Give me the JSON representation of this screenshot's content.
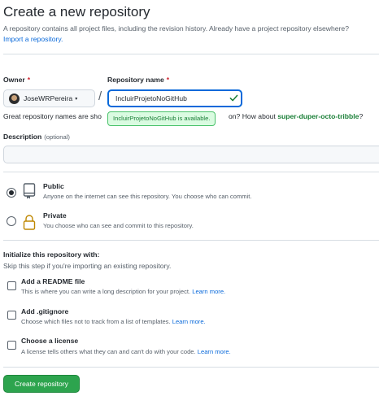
{
  "page": {
    "title": "Create a new repository",
    "subtitle": "A repository contains all project files, including the revision history. Already have a project repository elsewhere?",
    "import_link": "Import a repository."
  },
  "owner": {
    "label": "Owner",
    "required_mark": "*",
    "value": "JoseWRPereira",
    "caret": "▾"
  },
  "separator": "/",
  "repo_name": {
    "label": "Repository name",
    "required_mark": "*",
    "value": "IncluirProjetoNoGitHub",
    "availability_tooltip": "IncluirProjetoNoGitHub is available."
  },
  "hint": {
    "text_before": "Great repository names are sho",
    "text_after": "on? How about",
    "suggestion": "super-duper-octo-tribble",
    "end": "?"
  },
  "description": {
    "label": "Description",
    "optional": "(optional)",
    "value": ""
  },
  "visibility": {
    "public": {
      "title": "Public",
      "desc": "Anyone on the internet can see this repository. You choose who can commit.",
      "checked": true
    },
    "private": {
      "title": "Private",
      "desc": "You choose who can see and commit to this repository.",
      "checked": false
    }
  },
  "initialize": {
    "title": "Initialize this repository with:",
    "desc": "Skip this step if you're importing an existing repository.",
    "readme": {
      "title": "Add a README file",
      "desc": "This is where you can write a long description for your project.",
      "link": "Learn more."
    },
    "gitignore": {
      "title": "Add .gitignore",
      "desc": "Choose which files not to track from a list of templates.",
      "link": "Learn more."
    },
    "license": {
      "title": "Choose a license",
      "desc": "A license tells others what they can and can't do with your code.",
      "link": "Learn more."
    }
  },
  "create_button": "Create repository",
  "colors": {
    "primary_button": "#2da44e",
    "link": "#0969da",
    "success_text": "#1a7f37",
    "required": "#cf222e",
    "focus_border": "#0969da"
  },
  "icons": {
    "public": "repo-icon",
    "private": "lock-icon",
    "available": "check-icon"
  }
}
